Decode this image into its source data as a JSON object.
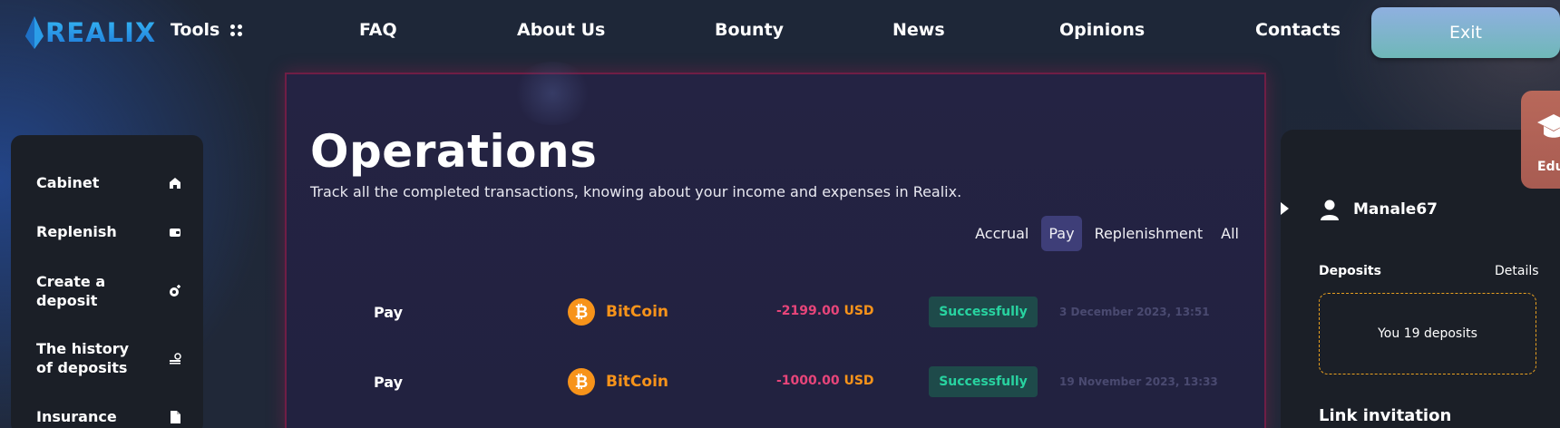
{
  "header": {
    "logo_text": "REALIX",
    "tools_label": "Tools",
    "nav": [
      "FAQ",
      "About Us",
      "Bounty",
      "News",
      "Opinions",
      "Contacts"
    ],
    "exit_label": "Exit"
  },
  "sidebar": {
    "items": [
      {
        "label": "Cabinet",
        "icon": "home-icon"
      },
      {
        "label": "Replenish",
        "icon": "wallet-icon"
      },
      {
        "label": "Create a deposit",
        "icon": "deposit-icon"
      },
      {
        "label": "The history of deposits",
        "icon": "history-icon"
      },
      {
        "label": "Insurance",
        "icon": "document-icon"
      }
    ]
  },
  "main": {
    "title": "Operations",
    "subtitle": "Track all the completed transactions, knowing about your income and expenses in Realix.",
    "filters": [
      "Accrual",
      "Pay",
      "Replenishment",
      "All"
    ],
    "active_filter": "Pay",
    "rows": [
      {
        "type": "Pay",
        "coin": "BitCoin",
        "amount": "-2199.00",
        "currency": "USD",
        "status": "Successfully",
        "date": "3 December 2023, 13:51"
      },
      {
        "type": "Pay",
        "coin": "BitCoin",
        "amount": "-1000.00",
        "currency": "USD",
        "status": "Successfully",
        "date": "19 November 2023, 13:33"
      }
    ]
  },
  "right_panel": {
    "username": "Manale67",
    "deposits_label": "Deposits",
    "details_label": "Details",
    "deposits_summary": "You 19 deposits",
    "link_invitation_label": "Link invitation"
  },
  "education_tab": {
    "label": "Edu"
  },
  "colors": {
    "accent_orange": "#f7931a",
    "negative_amount": "#e8457a",
    "success": "#28d3a0",
    "active_filter_bg": "#3e3e78"
  }
}
